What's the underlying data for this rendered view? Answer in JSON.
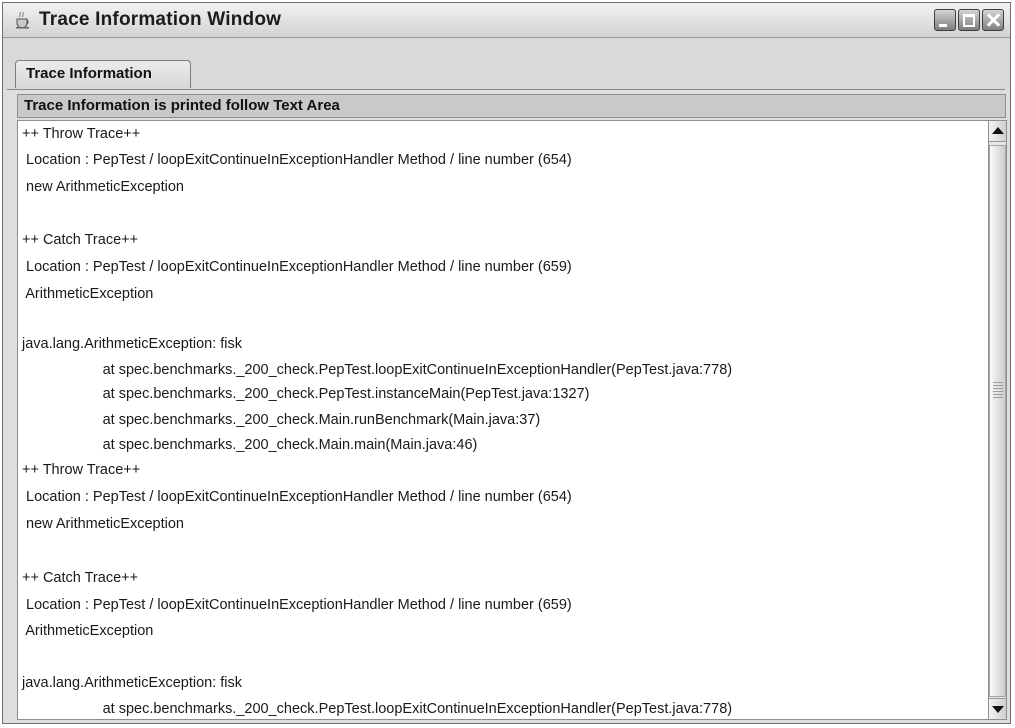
{
  "window": {
    "title": "Trace Information Window",
    "icon": "java-cup-icon",
    "controls": {
      "minimize": "minimize-icon",
      "maximize": "maximize-icon",
      "close": "close-icon"
    }
  },
  "tabs": [
    {
      "label": "Trace Information",
      "selected": true
    }
  ],
  "panel": {
    "header": "Trace Information is printed follow Text Area",
    "lines": [
      "++ Throw Trace++",
      " Location : PepTest / loopExitContinueInExceptionHandler Method / line number (654)",
      " new ArithmeticException",
      "",
      "++ Catch Trace++",
      " Location : PepTest / loopExitContinueInExceptionHandler Method / line number (659)",
      " ArithmeticException",
      "",
      "java.lang.ArithmeticException: fisk",
      "                    at spec.benchmarks._200_check.PepTest.loopExitContinueInExceptionHandler(PepTest.java:778)",
      "                    at spec.benchmarks._200_check.PepTest.instanceMain(PepTest.java:1327)",
      "                    at spec.benchmarks._200_check.Main.runBenchmark(Main.java:37)",
      "                    at spec.benchmarks._200_check.Main.main(Main.java:46)",
      "++ Throw Trace++",
      " Location : PepTest / loopExitContinueInExceptionHandler Method / line number (654)",
      " new ArithmeticException",
      "",
      "++ Catch Trace++",
      " Location : PepTest / loopExitContinueInExceptionHandler Method / line number (659)",
      " ArithmeticException",
      "",
      "java.lang.ArithmeticException: fisk",
      "                    at spec.benchmarks._200_check.PepTest.loopExitContinueInExceptionHandler(PepTest.java:778)"
    ]
  },
  "scrollbar": {
    "up": "arrow-up-icon",
    "down": "arrow-down-icon"
  }
}
